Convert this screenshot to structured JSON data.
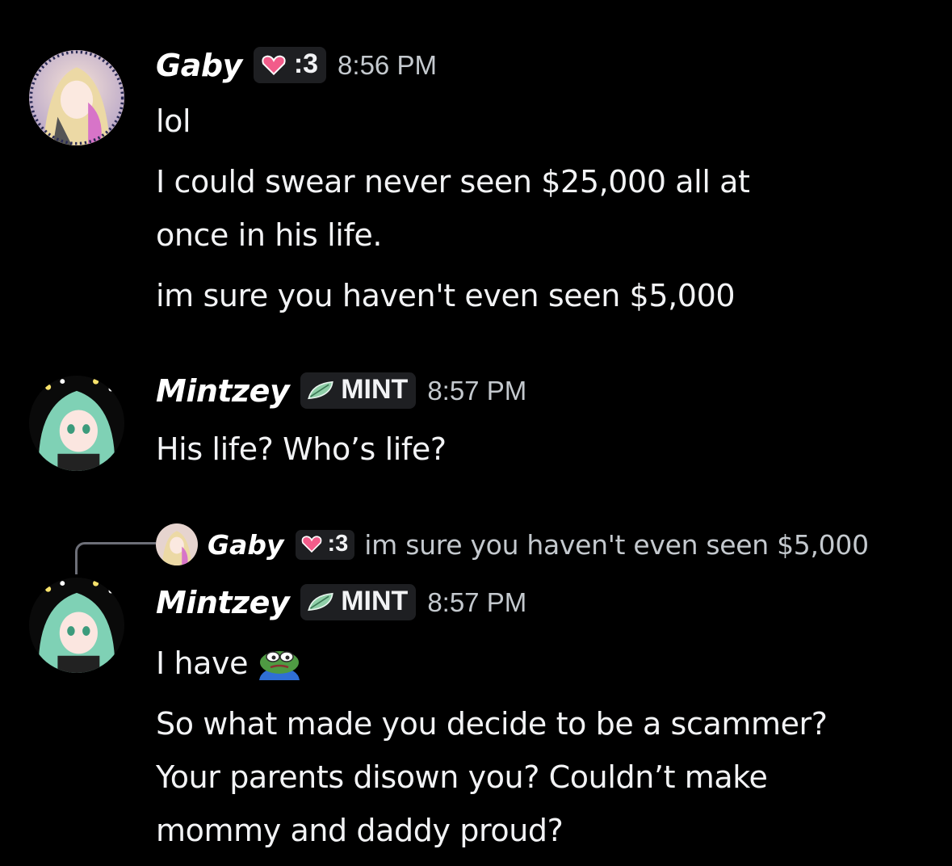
{
  "messages": [
    {
      "username": "Gaby",
      "tag": ":3",
      "tag_icon": "heart-icon",
      "time": "8:56 PM",
      "lines": [
        "lol",
        "I could swear never seen $25,000 all at",
        "once in his life.",
        "im sure you haven't even seen $5,000"
      ]
    },
    {
      "username": "Mintzey",
      "tag": "MINT",
      "tag_icon": "leaf-icon",
      "time": "8:57 PM",
      "lines": [
        "His life? Who’s life?"
      ]
    },
    {
      "reply": {
        "username": "Gaby",
        "tag": ":3",
        "text": "im sure you haven't even seen $5,000"
      },
      "username": "Mintzey",
      "tag": "MINT",
      "tag_icon": "leaf-icon",
      "time": "8:57 PM",
      "lines": [
        "I have",
        "So what made you decide to be a scammer?",
        "Your parents disown you? Couldn’t make",
        "mommy and daddy proud?"
      ],
      "emoji": "pepe-emoji"
    }
  ],
  "colors": {
    "background": "#000000",
    "text": "#f2f3f5",
    "muted": "#c4c9ce",
    "tag_bg": "#1e1f22"
  }
}
